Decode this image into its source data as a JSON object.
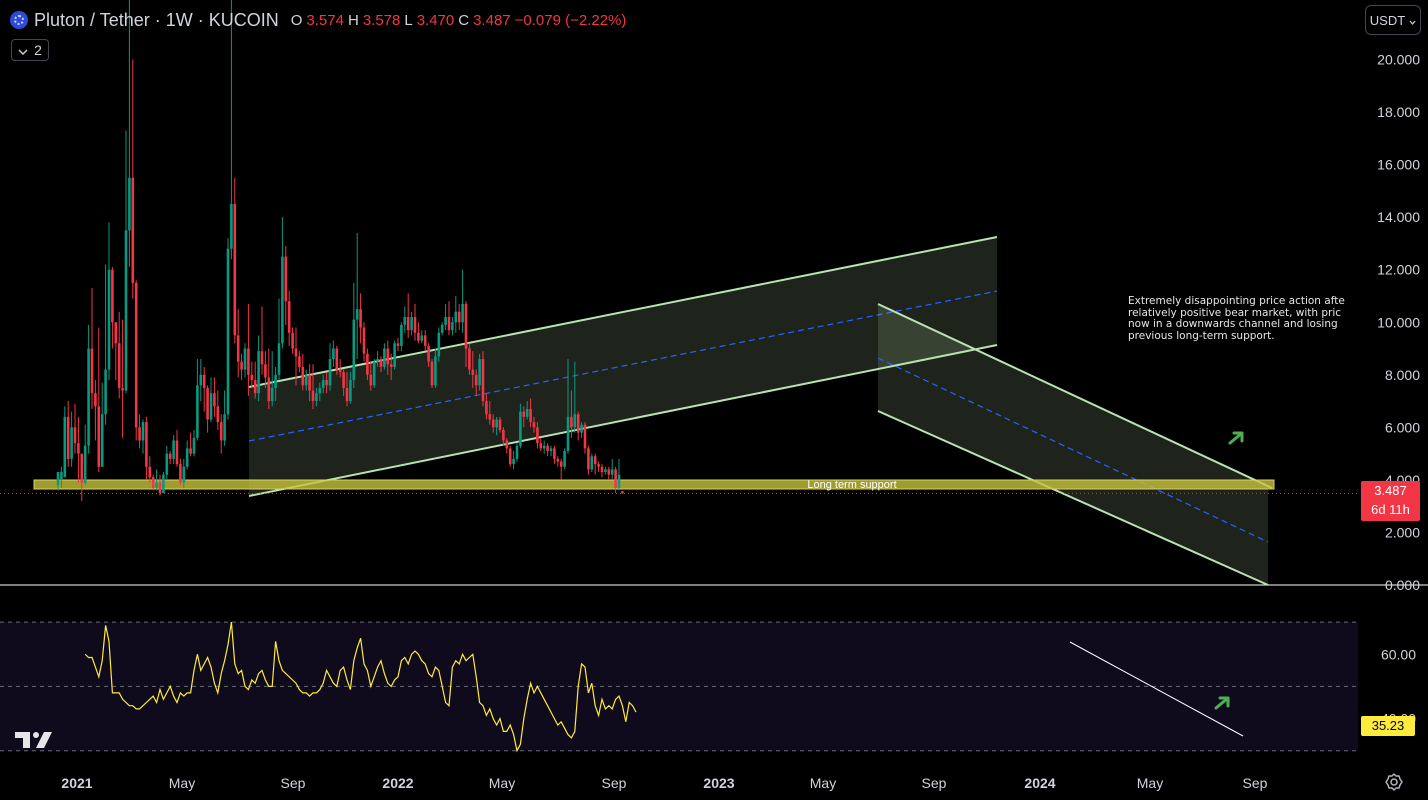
{
  "header": {
    "symbol": "Pluton / Tether · 1W · KUCOIN",
    "ohlc": [
      {
        "k": "O",
        "v": "3.574"
      },
      {
        "k": "H",
        "v": "3.578"
      },
      {
        "k": "L",
        "v": "3.470"
      },
      {
        "k": "C",
        "v": "3.487"
      }
    ],
    "change": "−0.079 (−2.22%)",
    "indicator_count": "2",
    "currency_button": "USDT"
  },
  "annotation": {
    "note": "Extremely disappointing price action afte\nrelatively positive bear market, with pric\nnow in a downwards channel and losing\nprevious long-term support.",
    "support_label": "Long term support"
  },
  "price_tag": {
    "price": "3.487",
    "countdown": "6d 11h"
  },
  "rsi_tag": "35.23",
  "colors": {
    "up": "#089981",
    "down": "#f23645",
    "rsi": "#ffeb3b",
    "channel": "#b9e2b1",
    "support": "#b5b23a",
    "arrow": "#4caf50"
  },
  "chart_data": [
    {
      "type": "candlestick",
      "title": "Pluton / Tether · 1W · KUCOIN",
      "x_ticks": [
        "2021",
        "May",
        "Sep",
        "2022",
        "May",
        "Sep",
        "2023",
        "May",
        "Sep",
        "2024",
        "May",
        "Sep"
      ],
      "y_ticks": [
        "0.000",
        "2.000",
        "4.000",
        "6.000",
        "8.000",
        "10.000",
        "12.000",
        "14.000",
        "16.000",
        "18.000",
        "20.000"
      ],
      "ylim": [
        0,
        21.2
      ],
      "grid": false,
      "ohlc_weekly": [
        [
          3.8,
          4.3,
          3.6,
          4.0
        ],
        [
          4.0,
          4.3,
          3.7,
          4.5
        ],
        [
          4.1,
          6.4,
          4.2,
          6.8
        ],
        [
          6.4,
          4.8,
          4.5,
          7.0
        ],
        [
          4.8,
          6.0,
          4.5,
          6.6
        ],
        [
          6.0,
          5.4,
          5.0,
          6.9
        ],
        [
          5.4,
          5.0,
          3.9,
          6.4
        ],
        [
          5.0,
          3.9,
          3.2,
          4.9
        ],
        [
          3.9,
          5.3,
          3.8,
          6.1
        ],
        [
          5.3,
          9.0,
          5.0,
          9.9
        ],
        [
          9.0,
          7.3,
          6.7,
          11.3
        ],
        [
          7.3,
          6.8,
          5.5,
          7.8
        ],
        [
          6.8,
          4.5,
          4.3,
          9.8
        ],
        [
          4.5,
          6.5,
          4.5,
          7.7
        ],
        [
          6.5,
          8.2,
          6.1,
          12.2
        ],
        [
          8.2,
          12.0,
          7.8,
          13.8
        ],
        [
          12.0,
          10.0,
          9.0,
          12.1
        ],
        [
          10.0,
          9.2,
          7.8,
          10.0
        ],
        [
          9.2,
          7.5,
          7.1,
          10.4
        ],
        [
          7.5,
          7.4,
          5.6,
          10.1
        ],
        [
          7.4,
          13.5,
          7.3,
          17.3
        ],
        [
          13.5,
          15.5,
          12.1,
          22.5
        ],
        [
          15.5,
          11.5,
          10.9,
          20.0
        ],
        [
          11.5,
          6.0,
          5.5,
          11.6
        ],
        [
          6.0,
          5.5,
          5.2,
          6.5
        ],
        [
          5.5,
          6.2,
          5.0,
          6.3
        ],
        [
          6.2,
          4.5,
          4.0,
          6.4
        ],
        [
          4.5,
          4.1,
          3.9,
          4.9
        ],
        [
          4.1,
          3.7,
          3.6,
          4.2
        ],
        [
          3.7,
          3.9,
          3.6,
          4.4
        ],
        [
          3.9,
          3.5,
          3.4,
          4.2
        ],
        [
          3.5,
          4.2,
          3.5,
          4.3
        ],
        [
          4.2,
          5.0,
          4.0,
          5.3
        ],
        [
          5.0,
          4.8,
          4.6,
          5.1
        ],
        [
          4.8,
          5.5,
          4.6,
          5.7
        ],
        [
          5.5,
          4.6,
          4.5,
          5.9
        ],
        [
          4.6,
          3.9,
          3.8,
          4.8
        ],
        [
          3.9,
          4.5,
          3.7,
          4.8
        ],
        [
          4.5,
          5.2,
          4.4,
          5.5
        ],
        [
          5.2,
          5.0,
          4.9,
          5.8
        ],
        [
          5.0,
          5.6,
          4.9,
          5.9
        ],
        [
          5.6,
          7.6,
          5.5,
          8.6
        ],
        [
          7.6,
          8.0,
          7.0,
          8.6
        ],
        [
          8.0,
          7.5,
          6.6,
          8.3
        ],
        [
          7.5,
          6.3,
          5.8,
          7.6
        ],
        [
          6.3,
          7.3,
          6.2,
          7.9
        ],
        [
          7.3,
          6.8,
          6.4,
          7.9
        ],
        [
          6.8,
          6.2,
          5.9,
          7.4
        ],
        [
          6.2,
          5.5,
          5.0,
          6.5
        ],
        [
          5.5,
          6.5,
          5.3,
          7.4
        ],
        [
          6.5,
          12.8,
          6.3,
          13.2
        ],
        [
          12.8,
          14.5,
          12.4,
          22.9
        ],
        [
          14.5,
          9.5,
          9.2,
          15.5
        ],
        [
          9.5,
          8.5,
          7.9,
          10.5
        ],
        [
          8.5,
          8.2,
          7.8,
          8.8
        ],
        [
          8.2,
          9.0,
          7.9,
          9.2
        ],
        [
          9.0,
          8.0,
          7.2,
          10.7
        ],
        [
          8.0,
          7.8,
          7.5,
          8.5
        ],
        [
          7.8,
          7.3,
          7.1,
          8.5
        ],
        [
          7.3,
          8.9,
          7.0,
          9.5
        ],
        [
          8.9,
          8.4,
          8.0,
          10.6
        ],
        [
          8.4,
          7.9,
          7.5,
          8.9
        ],
        [
          7.9,
          7.0,
          6.7,
          9.0
        ],
        [
          7.0,
          7.5,
          6.8,
          8.9
        ],
        [
          7.5,
          8.0,
          7.0,
          8.3
        ],
        [
          8.0,
          9.2,
          7.8,
          10.9
        ],
        [
          9.2,
          12.5,
          9.0,
          14.0
        ],
        [
          12.5,
          10.8,
          9.9,
          12.9
        ],
        [
          10.8,
          9.6,
          9.1,
          11.2
        ],
        [
          9.6,
          9.0,
          8.8,
          9.8
        ],
        [
          9.0,
          8.7,
          7.6,
          9.8
        ],
        [
          8.7,
          8.3,
          8.1,
          8.9
        ],
        [
          8.3,
          7.6,
          7.4,
          8.8
        ],
        [
          7.6,
          8.0,
          7.4,
          8.2
        ],
        [
          8.0,
          7.4,
          7.0,
          8.4
        ],
        [
          7.4,
          7.0,
          6.7,
          8.4
        ],
        [
          7.0,
          7.3,
          6.8,
          7.5
        ],
        [
          7.3,
          7.5,
          7.0,
          7.7
        ],
        [
          7.5,
          7.8,
          7.3,
          8.0
        ],
        [
          7.8,
          7.6,
          7.3,
          8.1
        ],
        [
          7.6,
          8.6,
          7.4,
          9.2
        ],
        [
          8.6,
          9.0,
          8.3,
          9.3
        ],
        [
          9.0,
          8.2,
          8.0,
          9.1
        ],
        [
          8.2,
          8.1,
          7.9,
          8.6
        ],
        [
          8.1,
          7.5,
          7.2,
          8.2
        ],
        [
          7.5,
          7.0,
          6.8,
          8.1
        ],
        [
          7.0,
          7.8,
          6.9,
          8.1
        ],
        [
          7.8,
          10.1,
          7.5,
          11.5
        ],
        [
          10.1,
          10.5,
          8.6,
          13.4
        ],
        [
          10.5,
          9.8,
          9.2,
          11.1
        ],
        [
          9.8,
          8.8,
          8.5,
          10.0
        ],
        [
          8.8,
          8.0,
          7.8,
          9.0
        ],
        [
          8.0,
          7.6,
          7.4,
          8.5
        ],
        [
          7.6,
          8.5,
          7.5,
          8.6
        ],
        [
          8.5,
          8.6,
          8.3,
          8.9
        ],
        [
          8.6,
          8.3,
          8.1,
          8.7
        ],
        [
          8.3,
          9.0,
          8.2,
          9.2
        ],
        [
          9.0,
          8.4,
          8.0,
          9.3
        ],
        [
          8.4,
          8.3,
          7.8,
          8.8
        ],
        [
          8.3,
          9.2,
          8.2,
          9.3
        ],
        [
          9.2,
          9.1,
          8.9,
          9.4
        ],
        [
          9.1,
          9.9,
          8.9,
          10.0
        ],
        [
          9.9,
          10.2,
          9.6,
          10.6
        ],
        [
          10.2,
          9.7,
          9.4,
          11.1
        ],
        [
          9.7,
          10.2,
          9.5,
          10.4
        ],
        [
          10.2,
          9.6,
          9.3,
          10.7
        ],
        [
          9.6,
          9.3,
          9.2,
          10.0
        ],
        [
          9.3,
          9.5,
          9.2,
          9.7
        ],
        [
          9.5,
          9.1,
          8.9,
          9.7
        ],
        [
          9.1,
          8.5,
          8.3,
          9.2
        ],
        [
          8.5,
          7.6,
          7.5,
          8.6
        ],
        [
          7.6,
          8.7,
          7.5,
          9.0
        ],
        [
          8.7,
          9.6,
          8.5,
          9.8
        ],
        [
          9.6,
          9.9,
          9.5,
          10.0
        ],
        [
          9.9,
          10.2,
          9.7,
          10.7
        ],
        [
          10.2,
          9.7,
          9.5,
          10.8
        ],
        [
          9.7,
          10.0,
          9.5,
          10.2
        ],
        [
          10.0,
          10.4,
          9.6,
          11.0
        ],
        [
          10.4,
          10.0,
          9.7,
          10.7
        ],
        [
          10.0,
          10.7,
          9.6,
          12.0
        ],
        [
          10.7,
          9.0,
          8.3,
          10.8
        ],
        [
          9.0,
          8.2,
          8.0,
          9.2
        ],
        [
          8.2,
          8.0,
          7.5,
          8.9
        ],
        [
          8.0,
          7.6,
          7.2,
          8.2
        ],
        [
          7.6,
          8.6,
          7.4,
          8.8
        ],
        [
          8.6,
          7.0,
          6.8,
          8.9
        ],
        [
          7.0,
          6.5,
          6.3,
          7.3
        ],
        [
          6.5,
          6.3,
          6.1,
          7.0
        ],
        [
          6.3,
          6.0,
          5.8,
          6.5
        ],
        [
          6.0,
          6.3,
          5.7,
          6.4
        ],
        [
          6.3,
          5.9,
          5.8,
          6.4
        ],
        [
          5.9,
          5.5,
          5.3,
          6.0
        ],
        [
          5.5,
          5.2,
          5.0,
          5.6
        ],
        [
          5.2,
          4.6,
          4.5,
          5.3
        ],
        [
          4.6,
          4.8,
          4.4,
          5.1
        ],
        [
          4.8,
          5.3,
          4.7,
          5.4
        ],
        [
          5.3,
          6.6,
          5.2,
          6.9
        ],
        [
          6.6,
          6.4,
          6.0,
          6.8
        ],
        [
          6.4,
          6.7,
          6.3,
          7.0
        ],
        [
          6.7,
          6.2,
          6.0,
          7.1
        ],
        [
          6.2,
          6.0,
          5.8,
          6.4
        ],
        [
          6.0,
          5.4,
          5.2,
          6.2
        ],
        [
          5.4,
          5.2,
          5.1,
          5.6
        ],
        [
          5.2,
          5.3,
          5.0,
          5.5
        ],
        [
          5.3,
          5.1,
          4.9,
          5.4
        ],
        [
          5.1,
          5.2,
          4.9,
          5.3
        ],
        [
          5.2,
          4.8,
          4.6,
          5.3
        ],
        [
          4.8,
          4.7,
          4.5,
          4.9
        ],
        [
          4.7,
          4.5,
          4.0,
          4.8
        ],
        [
          4.5,
          5.1,
          4.4,
          5.2
        ],
        [
          5.1,
          6.4,
          5.0,
          8.6
        ],
        [
          6.4,
          6.0,
          5.6,
          7.4
        ],
        [
          6.0,
          6.5,
          5.8,
          8.5
        ],
        [
          6.5,
          5.8,
          5.5,
          6.6
        ],
        [
          5.8,
          6.1,
          5.6,
          6.2
        ],
        [
          6.1,
          5.2,
          5.0,
          6.2
        ],
        [
          5.2,
          4.4,
          4.2,
          5.3
        ],
        [
          4.4,
          4.9,
          4.3,
          5.0
        ],
        [
          4.9,
          4.6,
          4.2,
          5.0
        ],
        [
          4.6,
          4.5,
          4.3,
          4.7
        ],
        [
          4.5,
          4.3,
          4.1,
          4.6
        ],
        [
          4.3,
          4.4,
          4.2,
          4.5
        ],
        [
          4.4,
          4.2,
          4.0,
          4.5
        ],
        [
          4.2,
          4.4,
          4.0,
          4.8
        ],
        [
          4.4,
          3.7,
          3.5,
          4.5
        ],
        [
          3.7,
          4.2,
          3.6,
          4.8
        ],
        [
          3.574,
          3.487,
          3.47,
          3.578
        ]
      ],
      "annotations": [
        "Long term support"
      ],
      "last_price": "3.487"
    },
    {
      "type": "line",
      "name": "RSI",
      "y_ticks": [
        "40.00",
        "60.00"
      ],
      "ylim": [
        24,
        80
      ],
      "hlines": [
        30,
        50,
        70
      ],
      "start_week": 8,
      "values": [
        60,
        59,
        59,
        56,
        53,
        58,
        69,
        64,
        48,
        48,
        48,
        46,
        45,
        44,
        44,
        43,
        43,
        44,
        45,
        46,
        47,
        45,
        49,
        46,
        48,
        50,
        47,
        45,
        48,
        47,
        48,
        48,
        55,
        60,
        55,
        57,
        59,
        56,
        51,
        48,
        54,
        58,
        63,
        70,
        57,
        54,
        55,
        50,
        49,
        52,
        51,
        54,
        55,
        52,
        50,
        50,
        64,
        58,
        55,
        54,
        53,
        52,
        51,
        49,
        48,
        48,
        47,
        48,
        48,
        49,
        51,
        55,
        53,
        51,
        50,
        55,
        56,
        52,
        49,
        58,
        62,
        65,
        57,
        55,
        50,
        53,
        56,
        58,
        54,
        51,
        50,
        52,
        53,
        58,
        59,
        57,
        60,
        61,
        60,
        58,
        57,
        54,
        53,
        56,
        55,
        50,
        45,
        44,
        56,
        58,
        57,
        60,
        58,
        59,
        60,
        53,
        45,
        44,
        41,
        43,
        40,
        38,
        40,
        36,
        36,
        38,
        35,
        30,
        32,
        40,
        46,
        51,
        48,
        50,
        48,
        46,
        44,
        42,
        40,
        38,
        39,
        37,
        35,
        34,
        36,
        50,
        57,
        56,
        48,
        51,
        44,
        41,
        46,
        43,
        44,
        43,
        46,
        47,
        44,
        39,
        45,
        44,
        42
      ]
    }
  ]
}
